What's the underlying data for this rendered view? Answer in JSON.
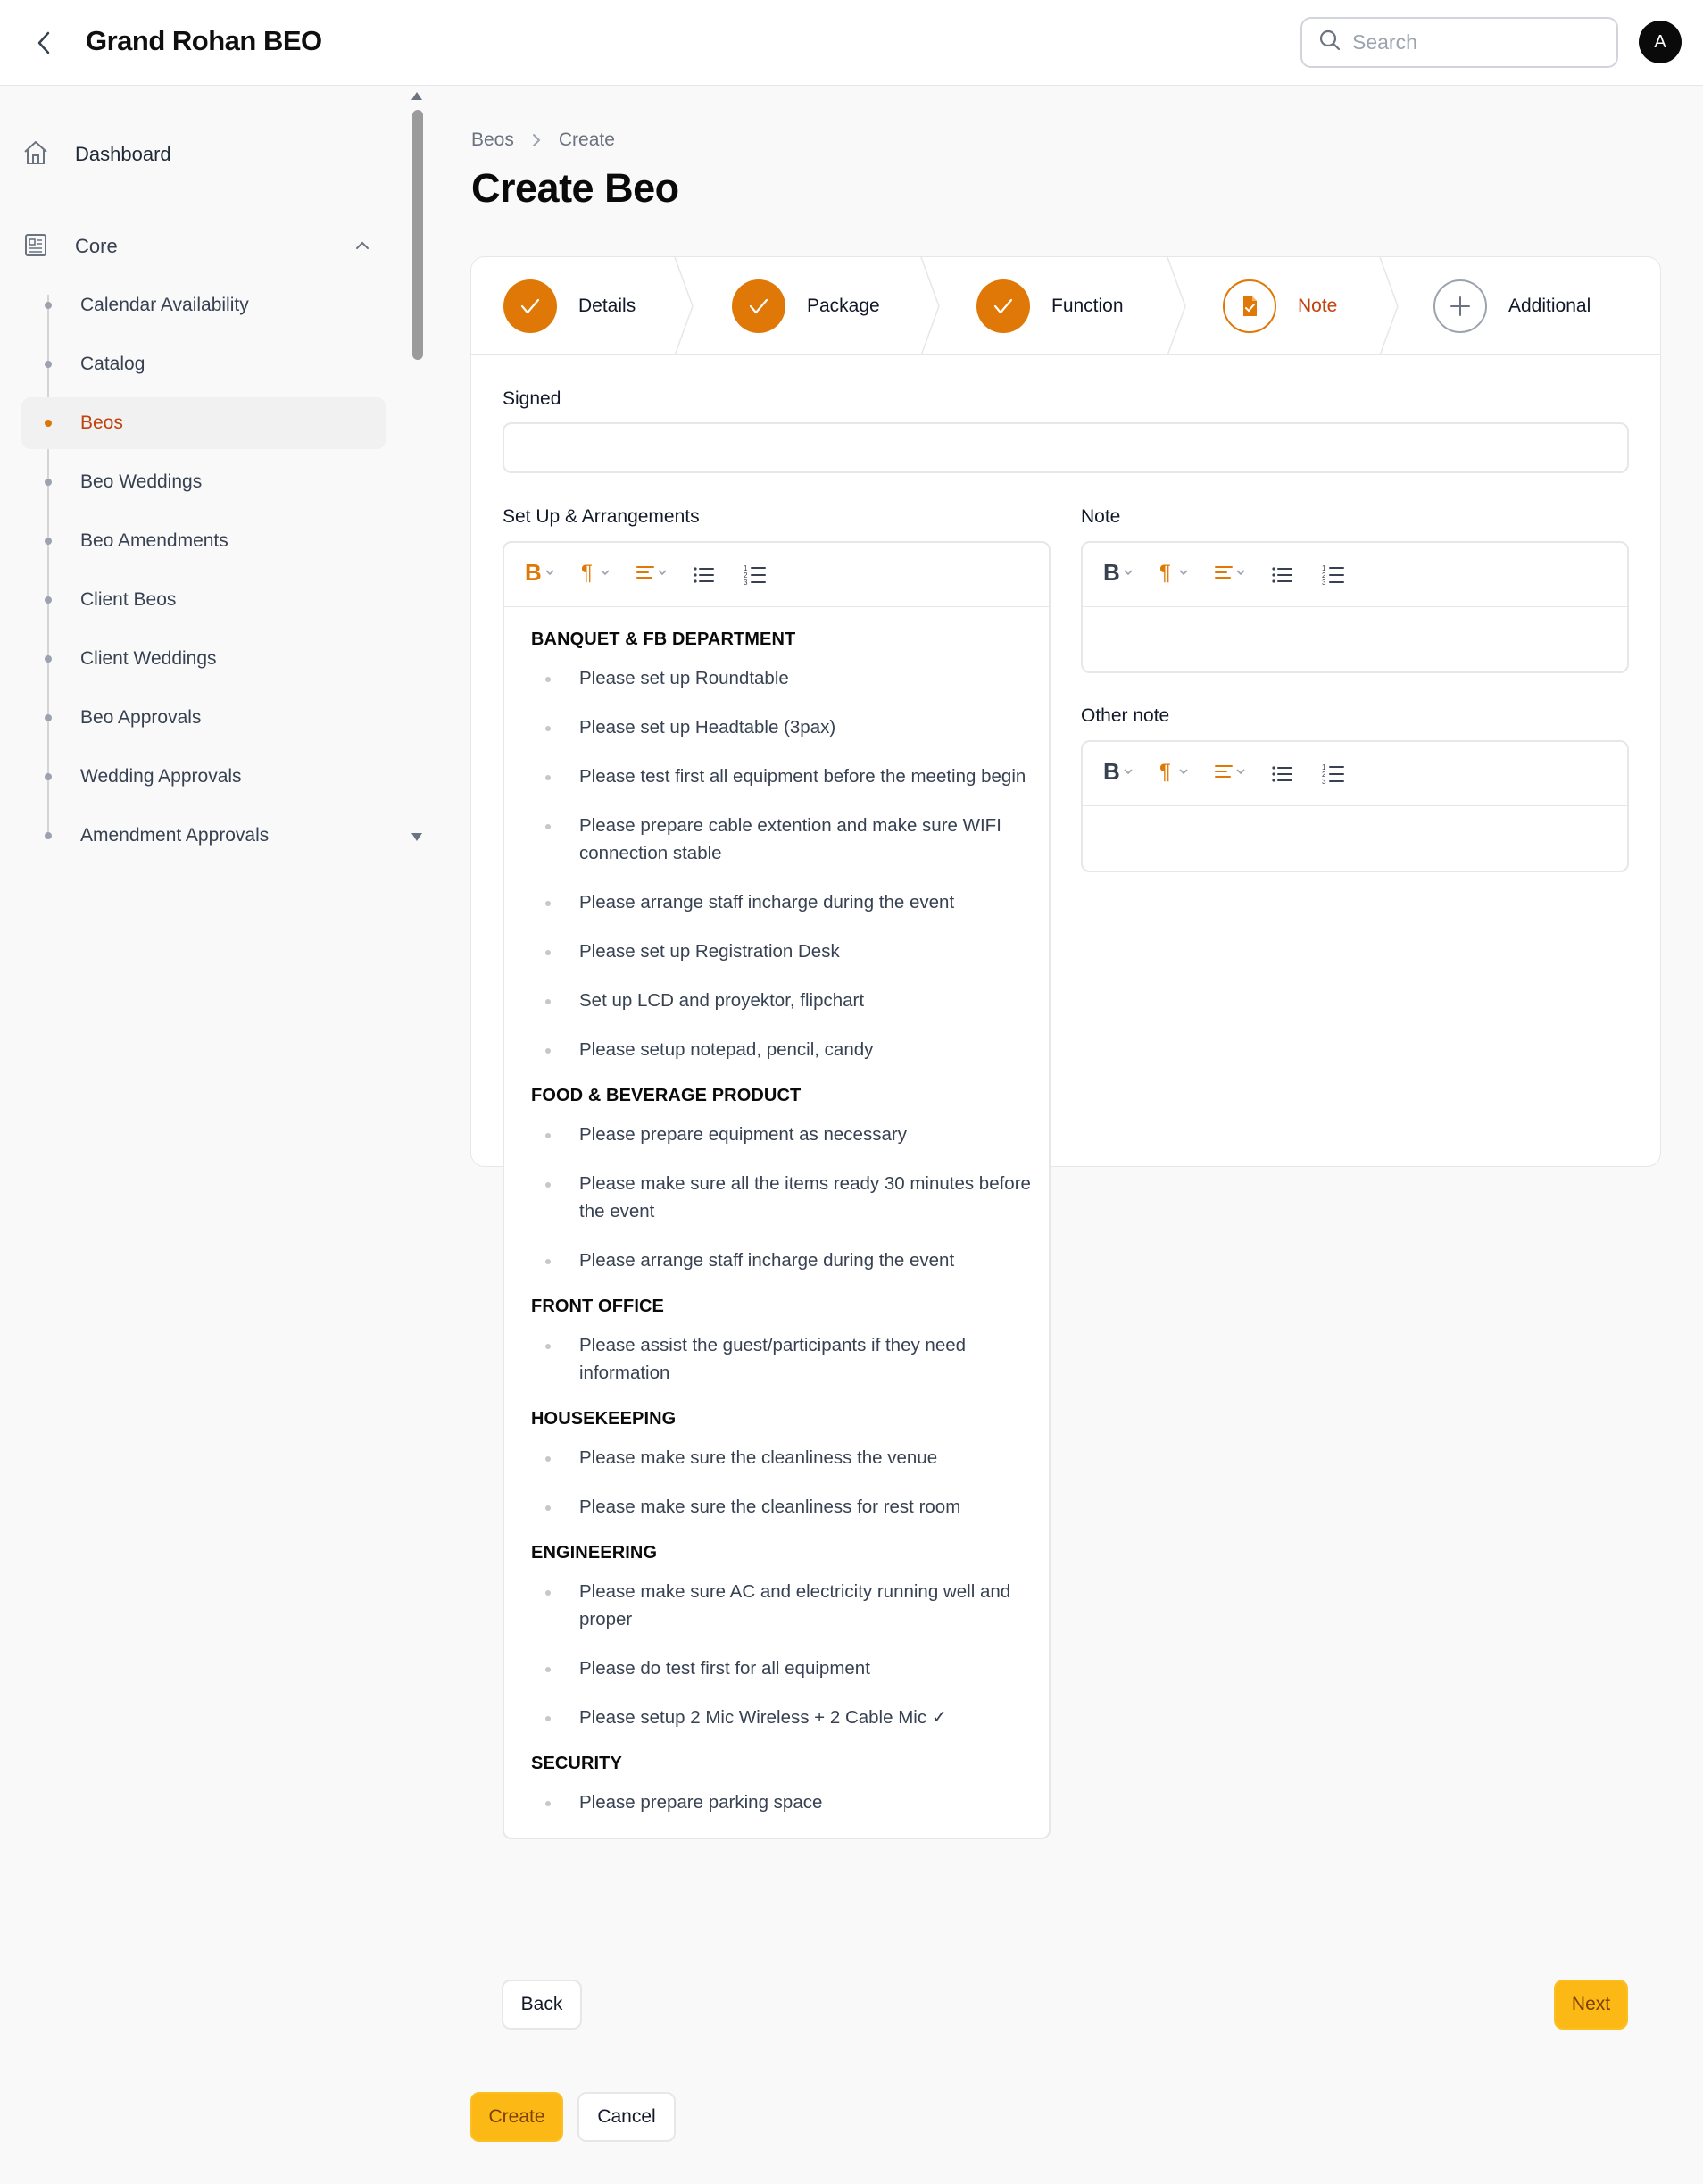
{
  "app": {
    "title": "Grand Rohan BEO",
    "avatar_initial": "A"
  },
  "search": {
    "placeholder": "Search"
  },
  "sidebar": {
    "dashboard": "Dashboard",
    "group": "Core",
    "items": [
      {
        "label": "Calendar Availability",
        "active": false
      },
      {
        "label": "Catalog",
        "active": false
      },
      {
        "label": "Beos",
        "active": true
      },
      {
        "label": "Beo Weddings",
        "active": false
      },
      {
        "label": "Beo Amendments",
        "active": false
      },
      {
        "label": "Client Beos",
        "active": false
      },
      {
        "label": "Client Weddings",
        "active": false
      },
      {
        "label": "Beo Approvals",
        "active": false
      },
      {
        "label": "Wedding Approvals",
        "active": false
      },
      {
        "label": "Amendment Approvals",
        "active": false
      }
    ]
  },
  "breadcrumb": [
    "Beos",
    "Create"
  ],
  "page": {
    "title": "Create Beo"
  },
  "steps": [
    {
      "label": "Details",
      "state": "done"
    },
    {
      "label": "Package",
      "state": "done"
    },
    {
      "label": "Function",
      "state": "done"
    },
    {
      "label": "Note",
      "state": "current"
    },
    {
      "label": "Additional",
      "state": "todo"
    }
  ],
  "form": {
    "signed_label": "Signed",
    "signed_value": "",
    "setup_label": "Set Up & Arrangements",
    "note_label": "Note",
    "other_note_label": "Other note",
    "setup_sections": [
      {
        "heading": "BANQUET & FB DEPARTMENT",
        "items": [
          "Please set up Roundtable",
          "Please set up Headtable (3pax)",
          "Please test first all equipment before the meeting begin",
          "Please prepare cable extention and make sure WIFI connection stable",
          "Please arrange staff incharge during the event",
          "Please set up Registration Desk",
          "Set up LCD and proyektor, flipchart",
          "Please setup notepad, pencil, candy"
        ]
      },
      {
        "heading": "FOOD & BEVERAGE PRODUCT",
        "items": [
          "Please prepare equipment as necessary",
          "Please make sure all the items ready 30 minutes before the event",
          "Please arrange staff incharge during the event"
        ]
      },
      {
        "heading": "FRONT OFFICE",
        "items": [
          "Please assist the guest/participants if they need information"
        ]
      },
      {
        "heading": "HOUSEKEEPING",
        "items": [
          "Please make sure the cleanliness the venue",
          "Please make sure the cleanliness for rest room"
        ]
      },
      {
        "heading": "ENGINEERING",
        "items": [
          "Please make sure AC and electricity running well and proper",
          "Please do test first for all equipment",
          "Please setup 2 Mic Wireless + 2 Cable Mic ✓"
        ]
      },
      {
        "heading": "SECURITY",
        "items": [
          "Please prepare parking space"
        ]
      }
    ]
  },
  "buttons": {
    "back": "Back",
    "next": "Next",
    "create": "Create",
    "cancel": "Cancel"
  },
  "colors": {
    "accent": "#e07807",
    "primary_button": "#fcb814",
    "active_nav": "#c2410c"
  }
}
